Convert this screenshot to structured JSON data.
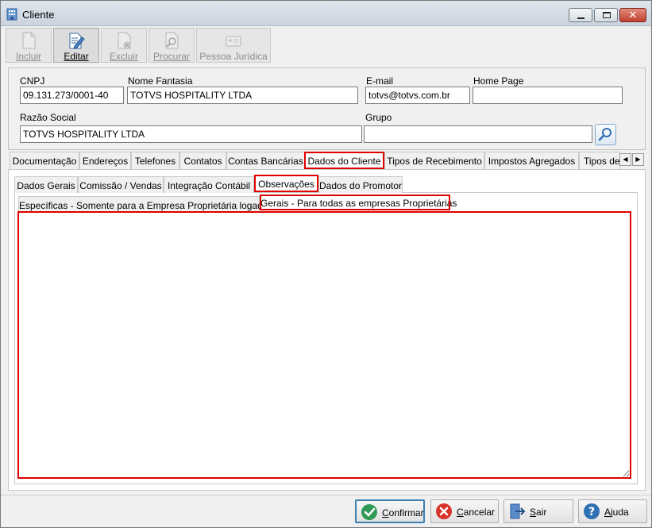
{
  "window": {
    "title": "Cliente"
  },
  "toolbar": {
    "incluir": "Incluir",
    "editar": "Editar",
    "excluir": "Excluir",
    "procurar": "Procurar",
    "pessoa_juridica": "Pessoa Jurídica"
  },
  "form": {
    "cnpj_label": "CNPJ",
    "cnpj_value": "09.131.273/0001-40",
    "nome_fantasia_label": "Nome Fantasia",
    "nome_fantasia_value": "TOTVS HOSPITALITY LTDA",
    "email_label": "E-mail",
    "email_value": "totvs@totvs.com.br",
    "home_page_label": "Home Page",
    "home_page_value": "",
    "razao_social_label": "Razão Social",
    "razao_social_value": "TOTVS HOSPITALITY LTDA",
    "grupo_label": "Grupo",
    "grupo_value": ""
  },
  "tabs_main": [
    "Documentação",
    "Endereços",
    "Telefones",
    "Contatos",
    "Contas Bancárias",
    "Dados do Cliente",
    "Tipos de Recebimento",
    "Impostos Agregados",
    "Tipos de"
  ],
  "tabs_cliente": [
    "Dados Gerais",
    "Comissão / Vendas",
    "Integração Contábil",
    "Observações",
    "Dados do Promotor"
  ],
  "tabs_observacoes": [
    "Específicas - Somente para a Empresa Proprietária logada",
    "Gerais - Para todas as empresas Proprietárias"
  ],
  "memo": {
    "value": ""
  },
  "buttons": {
    "confirmar": "Confirmar",
    "cancelar": "Cancelar",
    "sair": "Sair",
    "ajuda": "Ajuda"
  },
  "colors": {
    "highlight": "#e00000",
    "confirm": "#2e9a55",
    "cancel": "#d9342b",
    "help": "#2f6fb3"
  }
}
